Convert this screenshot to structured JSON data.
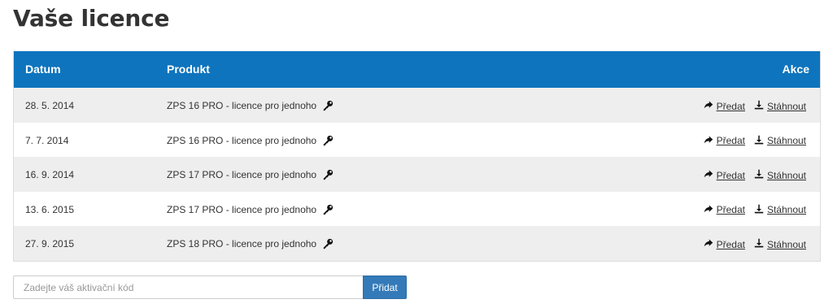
{
  "page": {
    "title": "Vaše licence"
  },
  "table": {
    "headers": {
      "date": "Datum",
      "product": "Produkt",
      "actions": "Akce"
    },
    "header_color": "#0e74bd",
    "rows": [
      {
        "date": "28. 5. 2014",
        "product": "ZPS 16 PRO - licence pro jednoho",
        "transfer": "Předat",
        "download": "Stáhnout"
      },
      {
        "date": "7. 7. 2014",
        "product": "ZPS 16 PRO - licence pro jednoho",
        "transfer": "Předat",
        "download": "Stáhnout"
      },
      {
        "date": "16. 9. 2014",
        "product": "ZPS 17 PRO - licence pro jednoho",
        "transfer": "Předat",
        "download": "Stáhnout"
      },
      {
        "date": "13. 6. 2015",
        "product": "ZPS 17 PRO - licence pro jednoho",
        "transfer": "Předat",
        "download": "Stáhnout"
      },
      {
        "date": "27. 9. 2015",
        "product": "ZPS 18 PRO - licence pro jednoho",
        "transfer": "Předat",
        "download": "Stáhnout"
      }
    ],
    "icons": {
      "product": "key-icon",
      "transfer": "share-arrow-icon",
      "download": "download-icon"
    }
  },
  "activation": {
    "placeholder": "Zadejte váš aktivační kód",
    "value": "",
    "button_label": "Přidat",
    "button_color": "#347ab8"
  }
}
